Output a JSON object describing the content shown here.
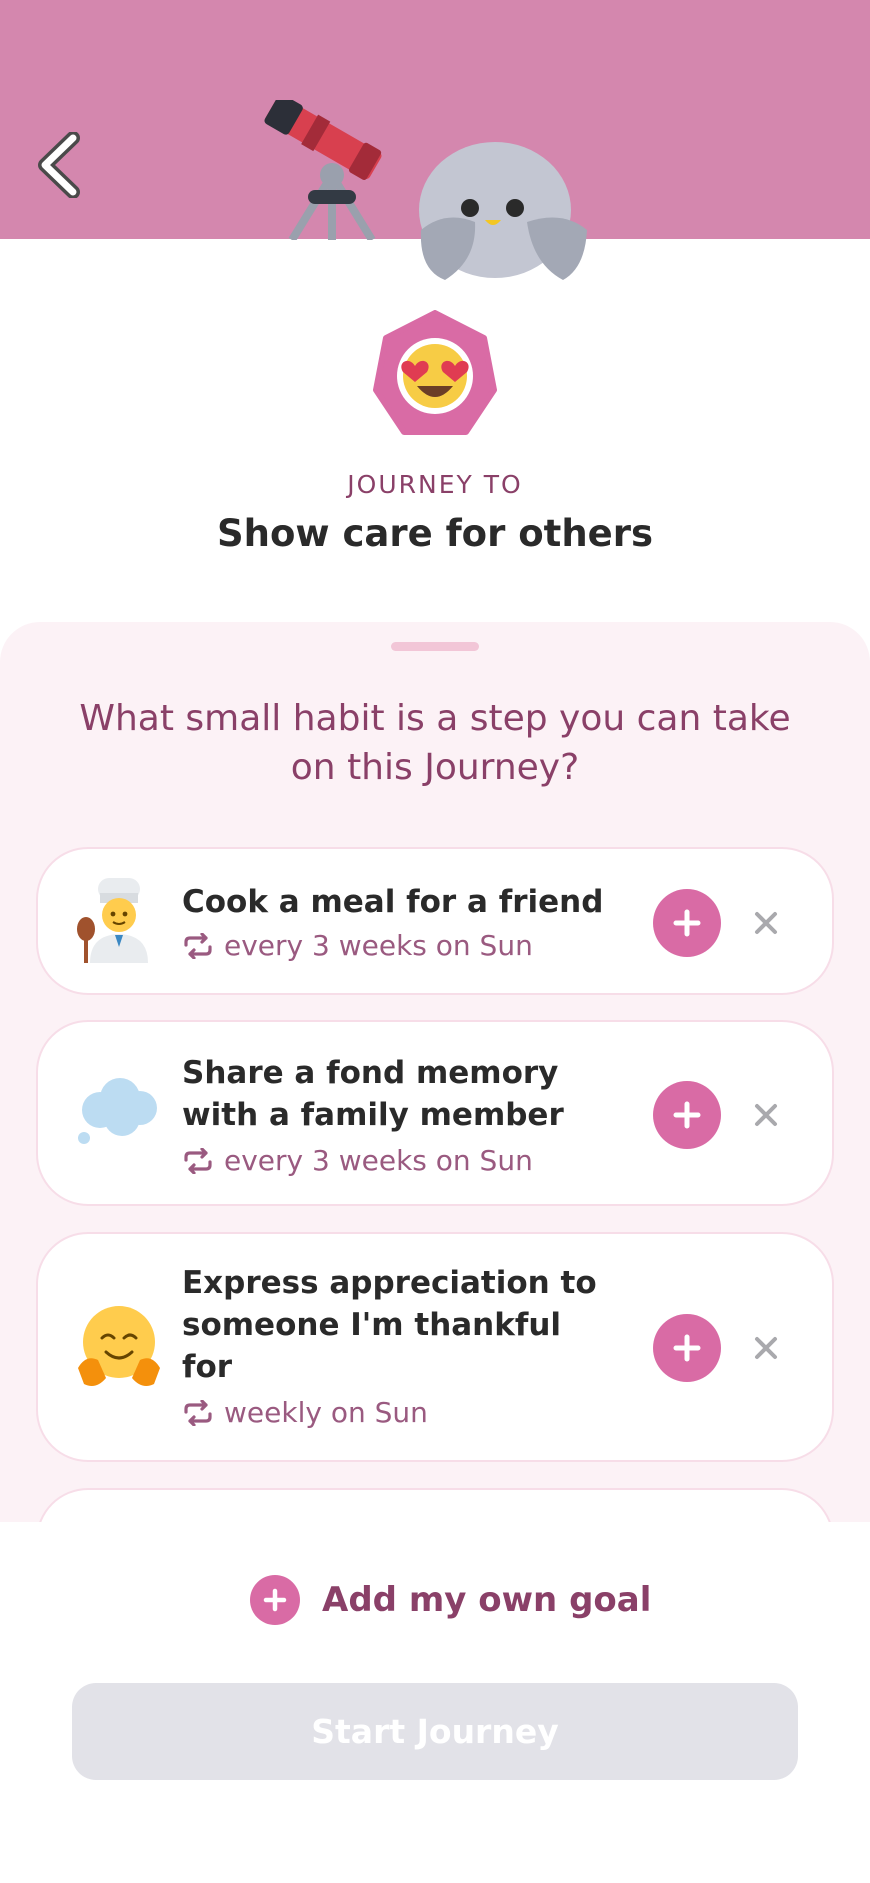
{
  "header": {
    "back_icon": "chevron-left-icon",
    "illustration_telescope": "telescope",
    "illustration_mascot": "penguin-mascot",
    "background_color": "#d487ae"
  },
  "journey": {
    "badge_emoji": "heart-eyes-emoji",
    "label": "JOURNEY TO",
    "title": "Show care for others"
  },
  "sheet": {
    "question": "What small habit is a step you can take on this Journey?",
    "background_color": "#fcf2f6"
  },
  "habits": [
    {
      "icon": "chef-emoji",
      "title": "Cook a meal for a friend",
      "frequency": "every 3 weeks on Sun"
    },
    {
      "icon": "thought-bubble-emoji",
      "title": "Share a fond memory with a family member",
      "frequency": "every 3 weeks on Sun"
    },
    {
      "icon": "hugging-face-emoji",
      "title": "Express appreciation to someone I'm thankful for",
      "frequency": "weekly on Sun"
    }
  ],
  "footer": {
    "add_own_goal_label": "Add my own goal",
    "start_button_label": "Start Journey",
    "accent_color": "#d96ba5"
  }
}
